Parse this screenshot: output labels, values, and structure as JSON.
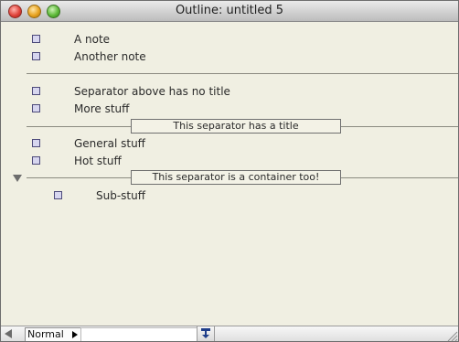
{
  "window": {
    "title": "Outline: untitled 5"
  },
  "outline": {
    "rows": [
      {
        "label": "A note"
      },
      {
        "label": "Another note"
      },
      {
        "label": "Separator above has no title"
      },
      {
        "label": "More stuff"
      },
      {
        "label": "General stuff"
      },
      {
        "label": "Hot stuff"
      },
      {
        "label": "Sub-stuff"
      }
    ],
    "separators": [
      {
        "title": ""
      },
      {
        "title": "This separator has a title"
      },
      {
        "title": "This separator is a container too!"
      }
    ]
  },
  "bottombar": {
    "style_value": "Normal",
    "icons": [
      "scroll-left-icon",
      "popup-arrow-icon",
      "split-handle-icon",
      "resize-grip-icon"
    ]
  },
  "colors": {
    "content_background": "#f0efe2",
    "bullet_fill": "#d7d6ef",
    "bullet_border": "#4d4a7a"
  }
}
